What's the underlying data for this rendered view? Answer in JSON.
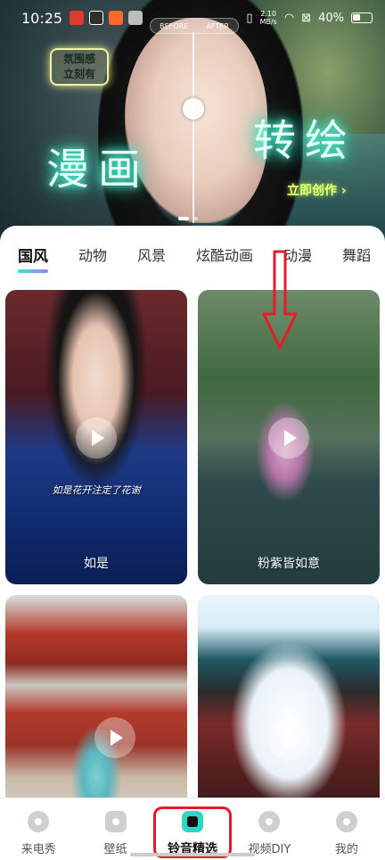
{
  "status_bar": {
    "time": "10:25",
    "network_speed": "2.10",
    "network_unit": "MB/s",
    "battery": "40%"
  },
  "banner": {
    "before_label": "BEFORE",
    "after_label": "AFTER",
    "tag_line1": "氛围感",
    "tag_line2": "立刻有",
    "left_title": "漫画",
    "right_title": "转绘",
    "cta": "立即创作 ›",
    "slide_index": 1,
    "slide_count": 2
  },
  "tabs": [
    {
      "label": "国风",
      "active": true
    },
    {
      "label": "动物",
      "active": false
    },
    {
      "label": "风景",
      "active": false
    },
    {
      "label": "炫酷动画",
      "active": false
    },
    {
      "label": "动漫",
      "active": false
    },
    {
      "label": "舞蹈",
      "active": false
    }
  ],
  "cards": [
    {
      "title": "如是",
      "subtitle": "如是花开注定了花谢"
    },
    {
      "title": "粉紫皆如意",
      "subtitle": ""
    },
    {
      "title": "",
      "subtitle": ""
    },
    {
      "title": "",
      "subtitle": ""
    }
  ],
  "bottom_nav": [
    {
      "label": "来电秀",
      "icon": "caller-show-icon",
      "active": false
    },
    {
      "label": "壁纸",
      "icon": "wallpaper-icon",
      "active": false
    },
    {
      "label": "铃音精选",
      "icon": "ringtone-icon",
      "active": true
    },
    {
      "label": "视频DIY",
      "icon": "video-diy-icon",
      "active": false
    },
    {
      "label": "我的",
      "icon": "profile-icon",
      "active": false
    }
  ],
  "colors": {
    "accent_teal": "#2dd6c4",
    "annotation_red": "#e81a2a",
    "neon_green": "#4ff5d2"
  }
}
